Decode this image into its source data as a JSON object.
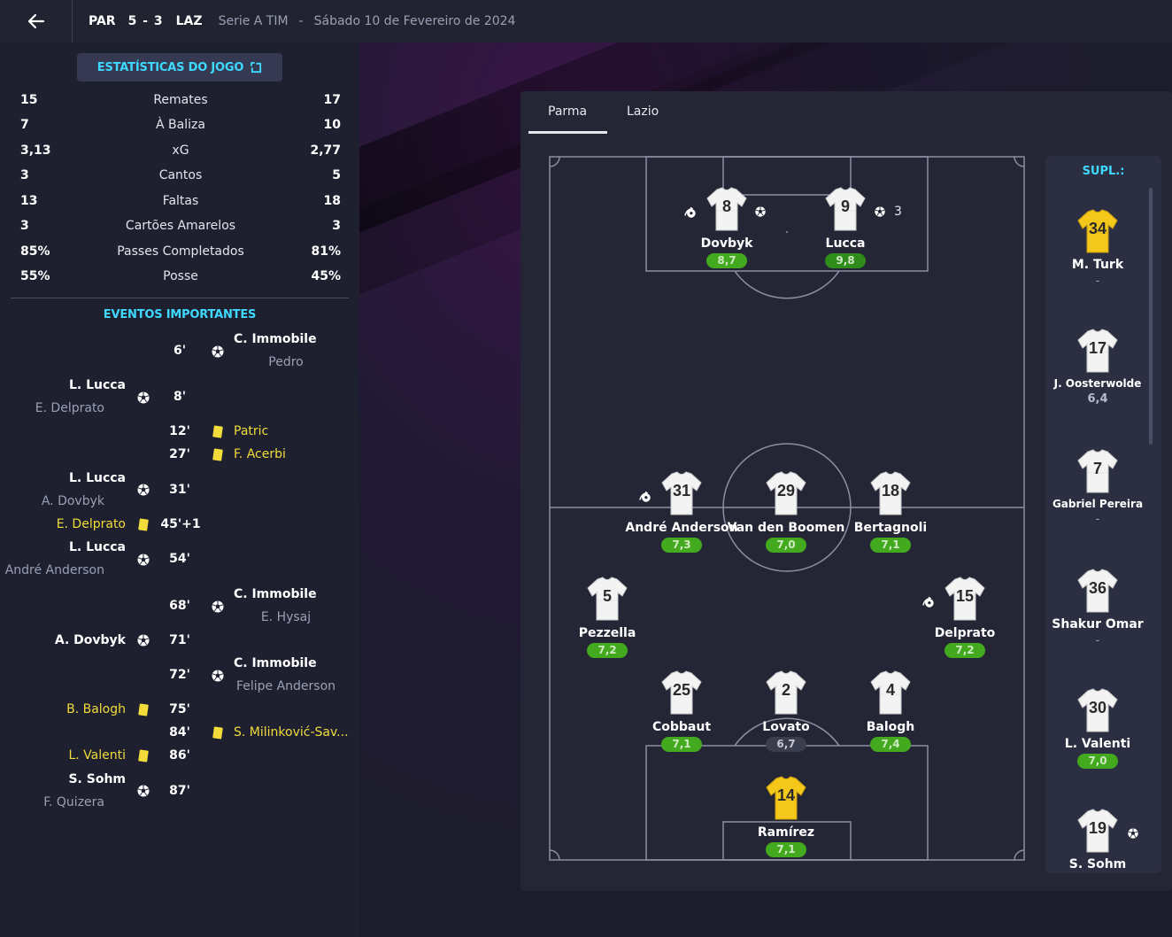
{
  "header": {
    "home_code": "PAR",
    "score": "5 - 3",
    "away_code": "LAZ",
    "competition": "Serie A TIM",
    "separator": "-",
    "date": "Sábado 10 de Fevereiro de 2024"
  },
  "stats_button": "ESTATÍSTICAS DO JOGO",
  "stats": [
    {
      "home": "15",
      "label": "Remates",
      "away": "17"
    },
    {
      "home": "7",
      "label": "À Baliza",
      "away": "10"
    },
    {
      "home": "3,13",
      "label": "xG",
      "away": "2,77"
    },
    {
      "home": "3",
      "label": "Cantos",
      "away": "5"
    },
    {
      "home": "13",
      "label": "Faltas",
      "away": "18"
    },
    {
      "home": "3",
      "label": "Cartões Amarelos",
      "away": "3"
    },
    {
      "home": "85%",
      "label": "Passes Completados",
      "away": "81%"
    },
    {
      "home": "55%",
      "label": "Posse",
      "away": "45%"
    }
  ],
  "events_title": "EVENTOS IMPORTANTES",
  "events": {
    "e1": {
      "minute": "6'",
      "main": "C. Immobile",
      "sub": "Pedro"
    },
    "e2": {
      "minute": "8'",
      "main": "L. Lucca",
      "sub": "E. Delprato"
    },
    "e3": {
      "minute": "12'",
      "main": "Patric"
    },
    "e4": {
      "minute": "27'",
      "main": "F. Acerbi"
    },
    "e5": {
      "minute": "31'",
      "main": "L. Lucca",
      "sub": "A. Dovbyk"
    },
    "e6": {
      "minute": "45'+1",
      "main": "E. Delprato"
    },
    "e7": {
      "minute": "54'",
      "main": "L. Lucca",
      "sub": "André Anderson"
    },
    "e8": {
      "minute": "68'",
      "main": "C. Immobile",
      "sub": "E. Hysaj"
    },
    "e9": {
      "minute": "71'",
      "main": "A. Dovbyk"
    },
    "e10": {
      "minute": "72'",
      "main": "C. Immobile",
      "sub": "Felipe Anderson"
    },
    "e11": {
      "minute": "75'",
      "main": "B. Balogh"
    },
    "e12": {
      "minute": "84'",
      "main": "S. Milinković-Sav..."
    },
    "e13": {
      "minute": "86'",
      "main": "L. Valenti"
    },
    "e14": {
      "minute": "87'",
      "main": "S. Sohm",
      "sub": "F. Quizera"
    }
  },
  "tabs": {
    "home": "Parma",
    "away": "Lazio"
  },
  "colors": {
    "accent": "#3fd9ff",
    "rating_green": "#43a91e",
    "yellow_card": "#f2dc3a",
    "keeper_shirt": "#f3c81a"
  },
  "lineup": {
    "dovbyk": {
      "num": "8",
      "name": "Dovbyk",
      "rating": "8,7"
    },
    "lucca": {
      "num": "9",
      "name": "Lucca",
      "rating": "9,8",
      "goals": "3"
    },
    "anderson": {
      "num": "31",
      "name": "André Anderson",
      "rating": "7,3"
    },
    "vdboomen": {
      "num": "29",
      "name": "Van den Boomen",
      "rating": "7,0"
    },
    "bertagnoli": {
      "num": "18",
      "name": "Bertagnoli",
      "rating": "7,1"
    },
    "pezzella": {
      "num": "5",
      "name": "Pezzella",
      "rating": "7,2"
    },
    "delprato": {
      "num": "15",
      "name": "Delprato",
      "rating": "7,2"
    },
    "cobbaut": {
      "num": "25",
      "name": "Cobbaut",
      "rating": "7,1"
    },
    "lovato": {
      "num": "2",
      "name": "Lovato",
      "rating": "6,7"
    },
    "balogh": {
      "num": "4",
      "name": "Balogh",
      "rating": "7,4"
    },
    "ramirez": {
      "num": "14",
      "name": "Ramírez",
      "rating": "7,1"
    }
  },
  "subs_title": "SUPL.:",
  "subs": {
    "turk": {
      "num": "34",
      "name": "M. Turk",
      "rating": "-"
    },
    "oosterwolde": {
      "num": "17",
      "name": "J. Oosterwolde",
      "rating": "6,4"
    },
    "pereira": {
      "num": "7",
      "name": "Gabriel Pereira",
      "rating": "-"
    },
    "omar": {
      "num": "36",
      "name": "Shakur Omar",
      "rating": "-"
    },
    "valenti": {
      "num": "30",
      "name": "L. Valenti",
      "rating": "7,0"
    },
    "sohm": {
      "num": "19",
      "name": "S. Sohm"
    }
  }
}
